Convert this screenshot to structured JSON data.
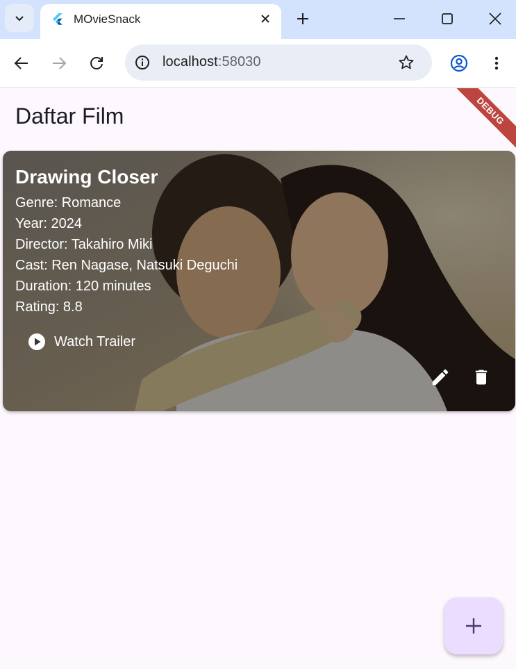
{
  "browser": {
    "tab_title": "MOvieSnack",
    "url_host": "localhost",
    "url_port": ":58030"
  },
  "app": {
    "page_title": "Daftar Film",
    "debug_label": "DEBUG",
    "accent_color": "#eaddff",
    "fab_icon": "add-icon"
  },
  "movies": [
    {
      "title": "Drawing Closer",
      "genre": "Genre: Romance",
      "year": "Year: 2024",
      "director": "Director: Takahiro Miki",
      "cast": "Cast: Ren Nagase, Natsuki Deguchi",
      "duration": "Duration: 120 minutes",
      "rating": "Rating: 8.8",
      "trailer_label": "Watch Trailer",
      "actions": [
        "edit-icon",
        "delete-icon"
      ]
    }
  ]
}
